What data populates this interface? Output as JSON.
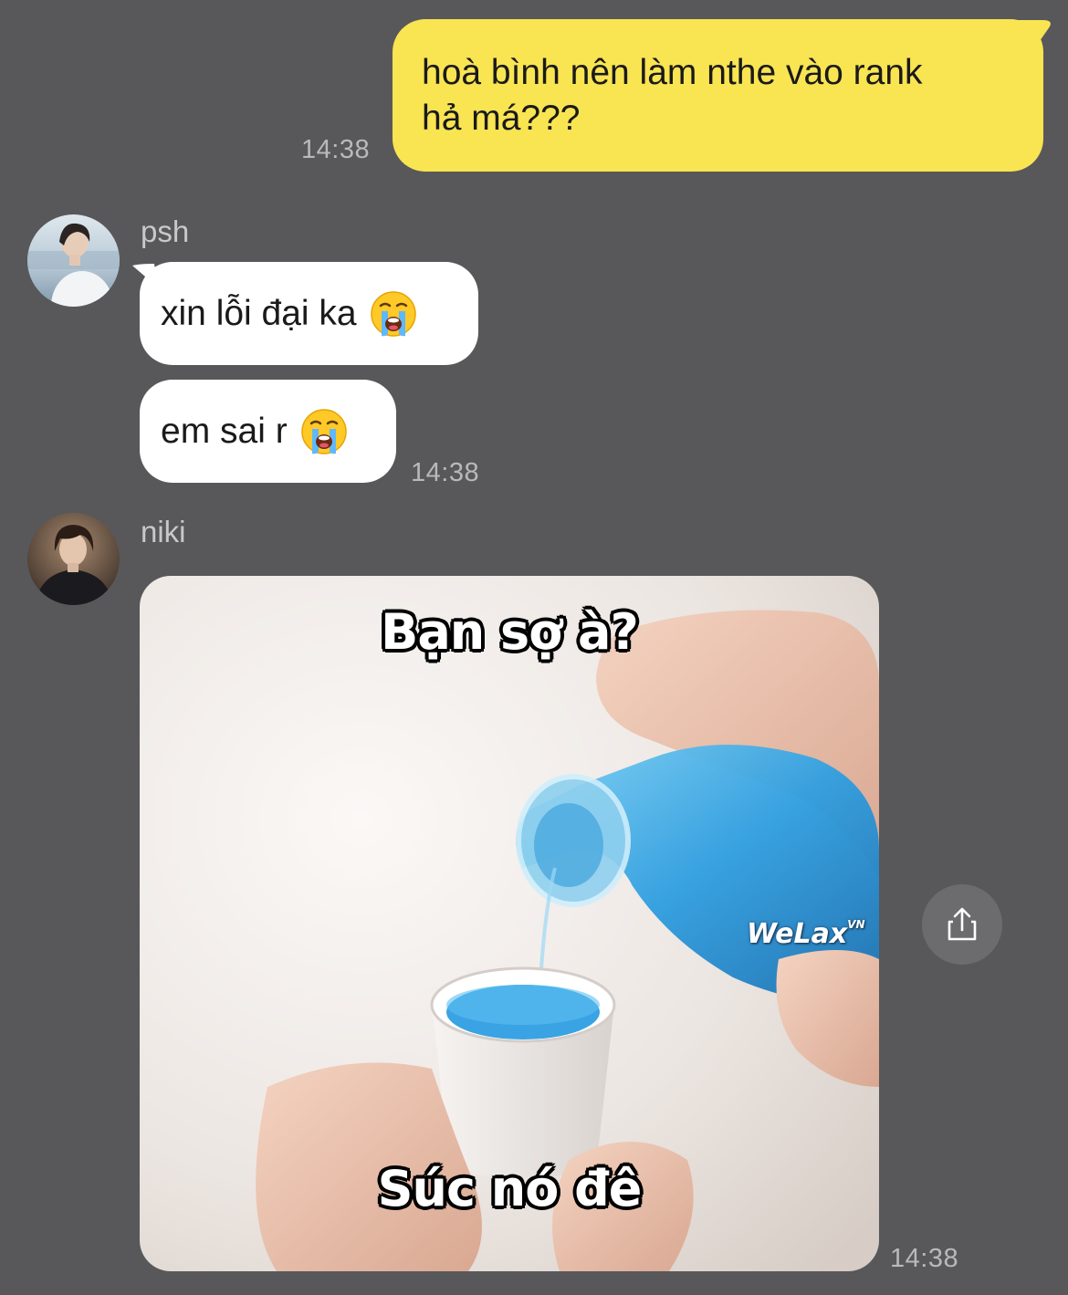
{
  "messages": {
    "outgoing": {
      "text_line1": "hoà bình nên làm nthe vào rank",
      "text_line2": "hả má???",
      "time": "14:38"
    },
    "psh": {
      "sender": "psh",
      "msg1": "xin lỗi đại ka",
      "msg2": "em sai r",
      "emoji": "loudly-crying-face",
      "time": "14:38"
    },
    "niki": {
      "sender": "niki",
      "image": {
        "caption_top": "Bạn sợ à?",
        "caption_bottom": "Súc nó đê",
        "watermark": "WeLax",
        "watermark_suffix": "VN"
      },
      "time": "14:38"
    }
  },
  "actions": {
    "share_icon": "share-icon"
  },
  "colors": {
    "background": "#58585a",
    "outgoing_bubble": "#f9e452",
    "incoming_bubble": "#ffffff",
    "timestamp": "#b9b9bb"
  }
}
